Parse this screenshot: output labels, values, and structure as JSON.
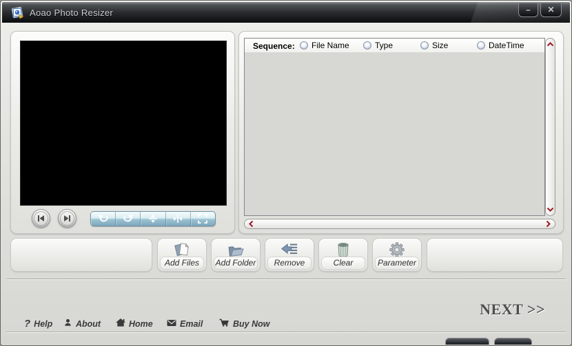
{
  "window": {
    "title": "Aoao Photo Resizer"
  },
  "titlebar": {
    "minimize_glyph": "–",
    "close_glyph": "✕"
  },
  "right_panel": {
    "sequence_label": "Sequence:",
    "sort_options": [
      {
        "label": "File Name",
        "selected": false
      },
      {
        "label": "Type",
        "selected": false
      },
      {
        "label": "Size",
        "selected": false
      },
      {
        "label": "DateTime",
        "selected": false
      }
    ],
    "file_list_items": []
  },
  "preview": {
    "toolbar_icons": [
      "prev-icon",
      "next-icon",
      "rotate-left-icon",
      "rotate-right-icon",
      "flip-vertical-icon",
      "flip-horizontal-icon",
      "maximize-icon"
    ]
  },
  "action_buttons": [
    {
      "label": "Add Files",
      "icon": "add-files-icon"
    },
    {
      "label": "Add Folder",
      "icon": "add-folder-icon"
    },
    {
      "label": "Remove",
      "icon": "remove-icon"
    },
    {
      "label": "Clear",
      "icon": "clear-icon"
    },
    {
      "label": "Parameter",
      "icon": "parameter-icon"
    }
  ],
  "footer": {
    "links": [
      {
        "label": "Help",
        "icon": "help-icon",
        "glyph": "?"
      },
      {
        "label": "About",
        "icon": "about-icon"
      },
      {
        "label": "Home",
        "icon": "home-icon"
      },
      {
        "label": "Email",
        "icon": "email-icon"
      },
      {
        "label": "Buy Now",
        "icon": "buy-now-icon"
      }
    ],
    "next_label": "NEXT >>"
  },
  "colors": {
    "titlebar_dark": "#0a0c0e",
    "scrollbar_arrow_red": "#a31621",
    "preview_toolbar_blue": "#7ea9bd",
    "panel_background": "#ecece9",
    "list_background": "#d7d7d4"
  }
}
